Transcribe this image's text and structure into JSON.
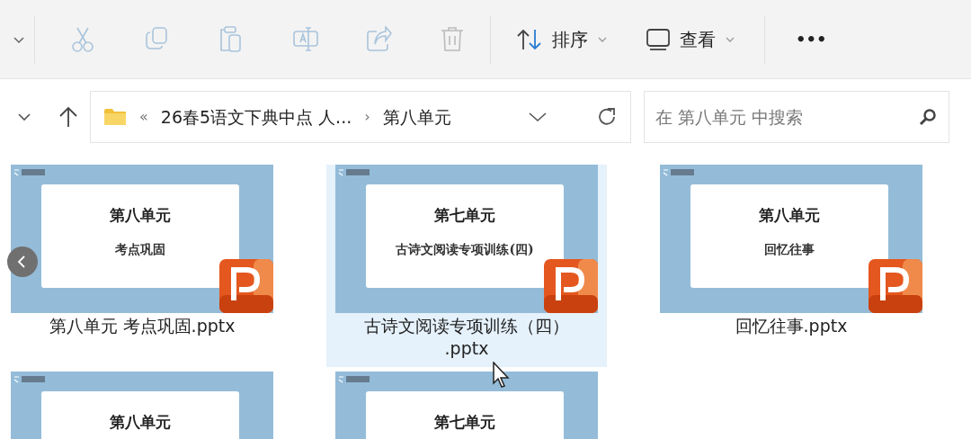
{
  "toolbar": {
    "sort_label": "排序",
    "view_label": "查看",
    "more": "•••"
  },
  "address": {
    "overflow": "«",
    "path": "26春5语文下典中点 人...",
    "separator": "›",
    "current": "第八单元"
  },
  "search": {
    "placeholder": "在 第八单元 中搜索"
  },
  "files": [
    {
      "name": "第八单元 考点巩固.pptx",
      "slide_title": "第八单元",
      "slide_subtitle": "考点巩固",
      "selected": false
    },
    {
      "name": "古诗文阅读专项训练（四）.pptx",
      "slide_title": "第七单元",
      "slide_subtitle": "古诗文阅读专项训练(四)",
      "selected": true
    },
    {
      "name": "回忆往事.pptx",
      "slide_title": "第八单元",
      "slide_subtitle": "回忆往事",
      "selected": false
    },
    {
      "slide_title": "第八单元",
      "selected": false
    },
    {
      "slide_title": "第七单元",
      "selected": false
    }
  ]
}
